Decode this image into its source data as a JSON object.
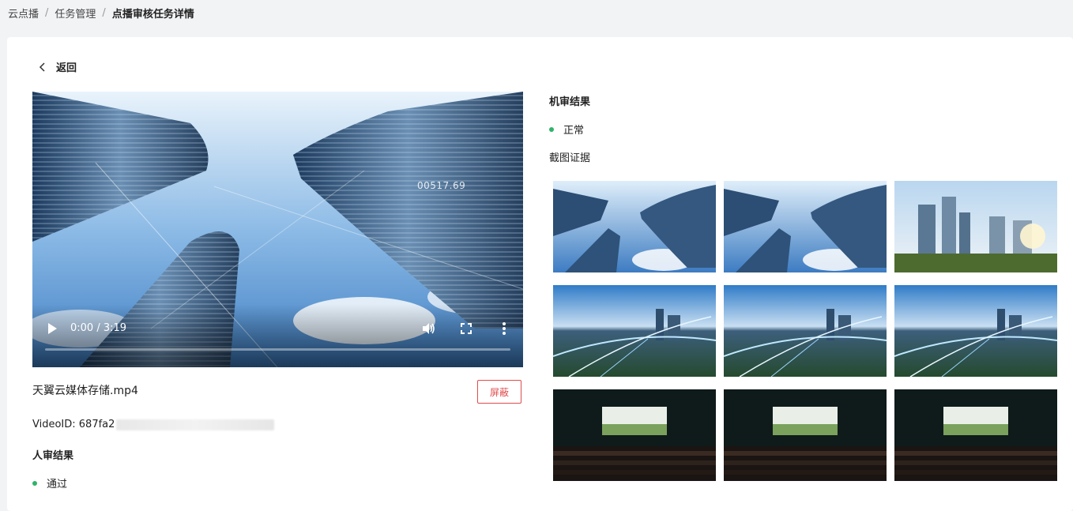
{
  "breadcrumb": {
    "items": [
      "云点播",
      "任务管理",
      "点播审核任务详情"
    ],
    "separator": "/"
  },
  "back": {
    "label": "返回"
  },
  "player": {
    "time": "0:00 / 3:19",
    "overlay_timestamp": "00517.69",
    "progress": 0
  },
  "file": {
    "name": "天翼云媒体存储.mp4",
    "block_label": "屏蔽",
    "video_id_label": "VideoID: 687fa2"
  },
  "human_review": {
    "title": "人审结果",
    "status": "通过"
  },
  "machine_review": {
    "title": "机审结果",
    "status": "正常"
  },
  "evidence": {
    "label": "截图证据",
    "thumbnails": [
      {
        "scene": "skyscrapers-sky"
      },
      {
        "scene": "skyscrapers-sky"
      },
      {
        "scene": "city-skyline-sunset"
      },
      {
        "scene": "aerial-city-lights"
      },
      {
        "scene": "aerial-city-lights"
      },
      {
        "scene": "aerial-city-lights"
      },
      {
        "scene": "cinema-screen"
      },
      {
        "scene": "cinema-screen"
      },
      {
        "scene": "cinema-screen"
      }
    ]
  },
  "colors": {
    "status_ok": "#2fb36b",
    "danger": "#e04b4b"
  }
}
